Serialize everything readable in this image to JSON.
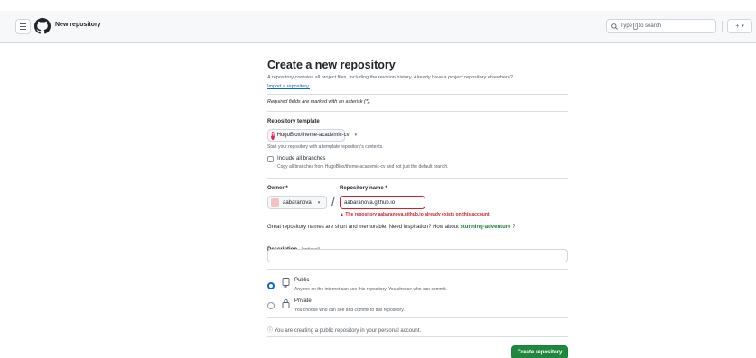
{
  "header": {
    "title": "New repository",
    "search_placeholder_prefix": "Type",
    "search_key": "/",
    "search_placeholder_suffix": "to search",
    "new_label": "+"
  },
  "form": {
    "title": "Create a new repository",
    "intro": "A repository contains all project files, including the revision history. Already have a project repository elsewhere?",
    "import_link": "Import a repository.",
    "required_note": "Required fields are marked with an asterisk (*).",
    "template": {
      "label": "Repository template",
      "selected": "HugoBlox/theme-academic-cv",
      "hint": "Start your repository with a template repository's contents."
    },
    "include_branches": {
      "label": "Include all branches",
      "hint": "Copy all branches from HugoBlox/theme-academic-cv and not just the default branch."
    },
    "owner": {
      "label": "Owner *",
      "value": "aabaranova"
    },
    "slash": "/",
    "repo_name": {
      "label": "Repository name *",
      "value": "aabaranova.github.io",
      "error": "The repository aabaranova.github.io already exists on this account."
    },
    "names_hint": "Great repository names are short and memorable. Need inspiration? How about",
    "suggestion": "stunning-adventure",
    "names_hint_end": "?",
    "description": {
      "label": "Description",
      "optional": "(optional)",
      "value": ""
    },
    "visibility": {
      "public": {
        "title": "Public",
        "desc": "Anyone on the internet can see this repository. You choose who can commit."
      },
      "private": {
        "title": "Private",
        "desc": "You choose who can see and commit to this repository."
      }
    },
    "info": "You are creating a public repository in your personal account.",
    "submit": "Create repository"
  },
  "colors": {
    "primary_button": "#1f883d",
    "link": "#0969da",
    "error": "#cf222e",
    "suggestion": "#1a7f37"
  }
}
